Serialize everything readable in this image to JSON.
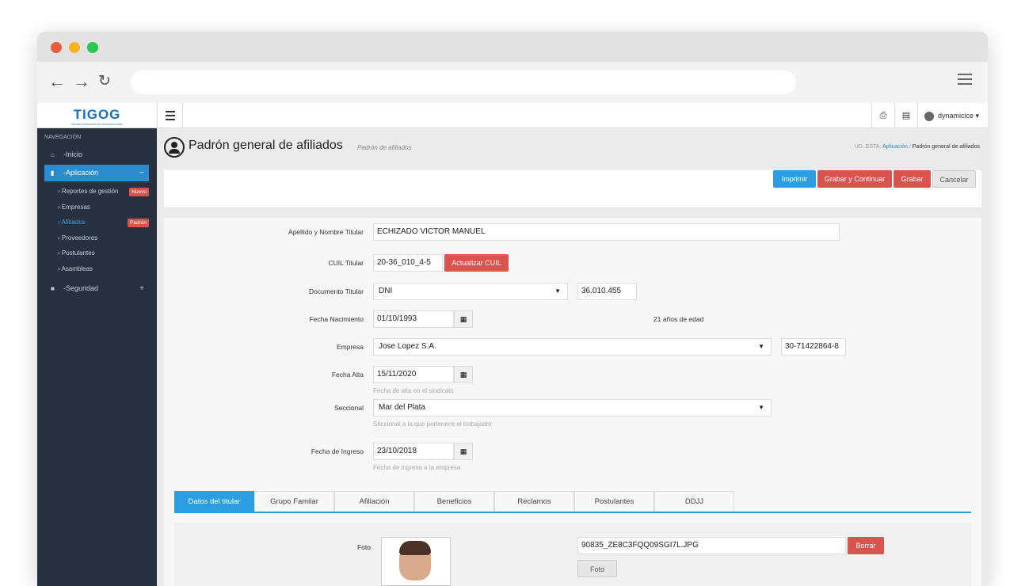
{
  "browser": {
    "back_icon": "arrow-left-icon",
    "forward_icon": "arrow-right-icon",
    "reload_icon": "reload-icon",
    "url": "",
    "menu_icon": "hamburger-icon"
  },
  "topbar": {
    "logo_text": "TIGOG",
    "logo_sub": "SISTEMA INTEGRADO DE ORGANIZACIONES",
    "user_name": "dynamicice",
    "print_icon": "printer-icon",
    "calc_icon": "calculator-icon"
  },
  "sidebar": {
    "heading": "NAVEGACIÓN",
    "items": [
      {
        "label": "-Inicio",
        "icon": "home-icon"
      },
      {
        "label": "-Aplicación",
        "icon": "file-icon",
        "toggle": "−"
      },
      {
        "label": "-Seguridad",
        "icon": "lock-icon",
        "toggle": "+"
      }
    ],
    "subitems": [
      {
        "label": "Reportes de gestión",
        "badge": "Nuevo"
      },
      {
        "label": "Empresas"
      },
      {
        "label": "Afiliados",
        "badge": "Padrón"
      },
      {
        "label": "Proveedores"
      },
      {
        "label": "Postulantes"
      },
      {
        "label": "Asambleas"
      }
    ]
  },
  "page": {
    "title": "Padrón general de afiliados",
    "subtitle": "Padrón de afiliados",
    "breadcrumb_prefix": "UD. ESTA:",
    "breadcrumb_link": "Aplicación",
    "breadcrumb_sep": "/",
    "breadcrumb_current": "Padrón general de afiliados"
  },
  "actions": {
    "print": "Imprimir",
    "save_continue": "Grabar y Continuar",
    "save": "Grabar",
    "cancel": "Cancelar"
  },
  "form": {
    "titular_label": "Apellido y Nombre Titular",
    "titular_value": "ECHIZADO  VICTOR MANUEL",
    "cuil_label": "CUIL Titular",
    "cuil_value": "20-36_010_4-5",
    "cuil_button": "Actualizar CUIL",
    "doc_label": "Documento Titular",
    "doc_type": "DNI",
    "doc_number": "36.010.455",
    "birth_label": "Fecha Nacimiento",
    "birth_value": "01/10/1993",
    "age_text": "21 años de edad",
    "company_label": "Empresa",
    "company_value": "Jose Lopez S.A.",
    "company_cuit": "30-71422864-8",
    "alta_label": "Fecha Alta",
    "alta_value": "15/11/2020",
    "alta_help": "Fecha de alta en el sindicato",
    "seccional_label": "Seccional",
    "seccional_value": "Mar del Plata",
    "seccional_help": "Seccional a la que pertenece el trabajador",
    "ingreso_label": "Fecha de Ingreso",
    "ingreso_value": "23/10/2018",
    "ingreso_help": "Fecha de ingreso a la empresa",
    "calendar_icon": "calendar-icon"
  },
  "tabs": [
    "Datos del titular",
    "Grupo Familar",
    "Afiliación",
    "Beneficios",
    "Reclamos",
    "Postulantes",
    "DDJJ"
  ],
  "tab_panel": {
    "photo_label": "Foto",
    "file_name": "90835_ZE8C3FQQ09SGI7L.JPG",
    "delete_button": "Borrar",
    "photo_button": "Foto"
  },
  "colors": {
    "accent": "#2a9ee0",
    "danger": "#d9534f",
    "sidebar": "#27313f"
  }
}
